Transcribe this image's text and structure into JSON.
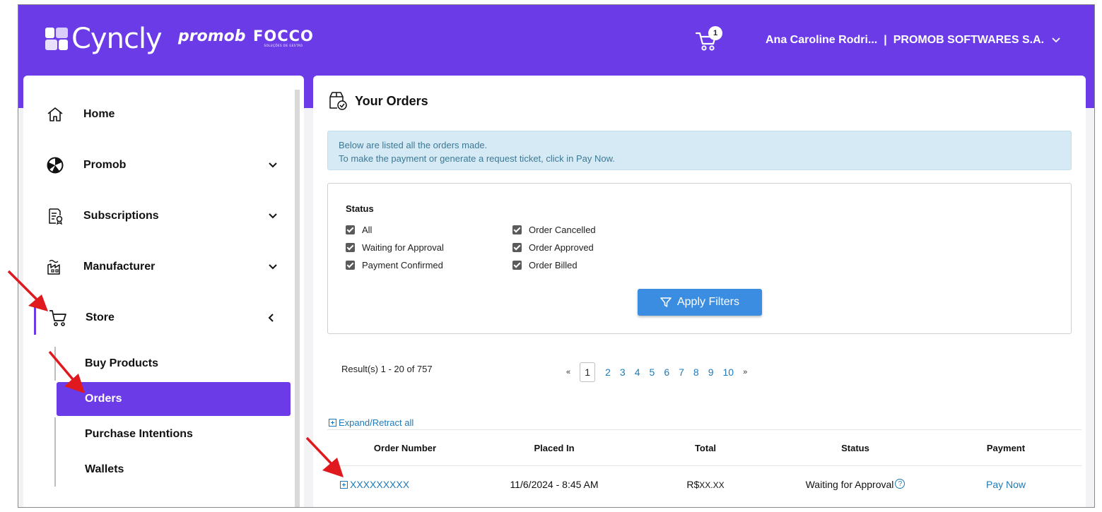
{
  "brand": {
    "cyncly": "Cyncly",
    "promob": "promob",
    "focco": "FOCCO",
    "focco_tagline": "SOLUÇÕES DE GESTÃO"
  },
  "header": {
    "cart_count": "1",
    "user_name": "Ana Caroline Rodri...",
    "separator": "|",
    "company": "PROMOB SOFTWARES S.A."
  },
  "sidebar": {
    "items": [
      {
        "label": "Home",
        "icon": "home-icon"
      },
      {
        "label": "Promob",
        "icon": "promob-icon"
      },
      {
        "label": "Subscriptions",
        "icon": "subscriptions-icon"
      },
      {
        "label": "Manufacturer",
        "icon": "factory-icon"
      },
      {
        "label": "Store",
        "icon": "cart-icon"
      }
    ],
    "store_sub": [
      {
        "label": "Buy Products"
      },
      {
        "label": "Orders"
      },
      {
        "label": "Purchase Intentions"
      },
      {
        "label": "Wallets"
      }
    ]
  },
  "page": {
    "title": "Your Orders",
    "info_line1": "Below are listed all the orders made.",
    "info_line2": "To make the payment or generate a request ticket, click in Pay Now."
  },
  "filters": {
    "title": "Status",
    "options": [
      {
        "label": "All",
        "checked": true
      },
      {
        "label": "Waiting for Approval",
        "checked": true
      },
      {
        "label": "Payment Confirmed",
        "checked": true
      },
      {
        "label": "Order Cancelled",
        "checked": true
      },
      {
        "label": "Order Approved",
        "checked": true
      },
      {
        "label": "Order Billed",
        "checked": true
      }
    ],
    "apply_label": "Apply Filters"
  },
  "results": {
    "summary": "Result(s) 1 - 20 of 757",
    "prev": "«",
    "next": "»",
    "current_page": "1",
    "pages": [
      "2",
      "3",
      "4",
      "5",
      "6",
      "7",
      "8",
      "9",
      "10"
    ]
  },
  "table": {
    "expand_label": "Expand/Retract all",
    "headers": [
      "Order Number",
      "Placed In",
      "Total",
      "Status",
      "Payment"
    ],
    "rows": [
      {
        "order_number": "XXXXXXXXX",
        "placed_in": "11/6/2024 - 8:45 AM",
        "currency": "R$",
        "total": "XX.XX",
        "status": "Waiting for Approval",
        "payment": "Pay Now"
      }
    ]
  },
  "colors": {
    "brand": "#6b3be8",
    "link": "#1f7ab8",
    "button": "#3a8de0",
    "info_bg": "#d5eaf4",
    "annotation_arrow": "#e0191e"
  }
}
